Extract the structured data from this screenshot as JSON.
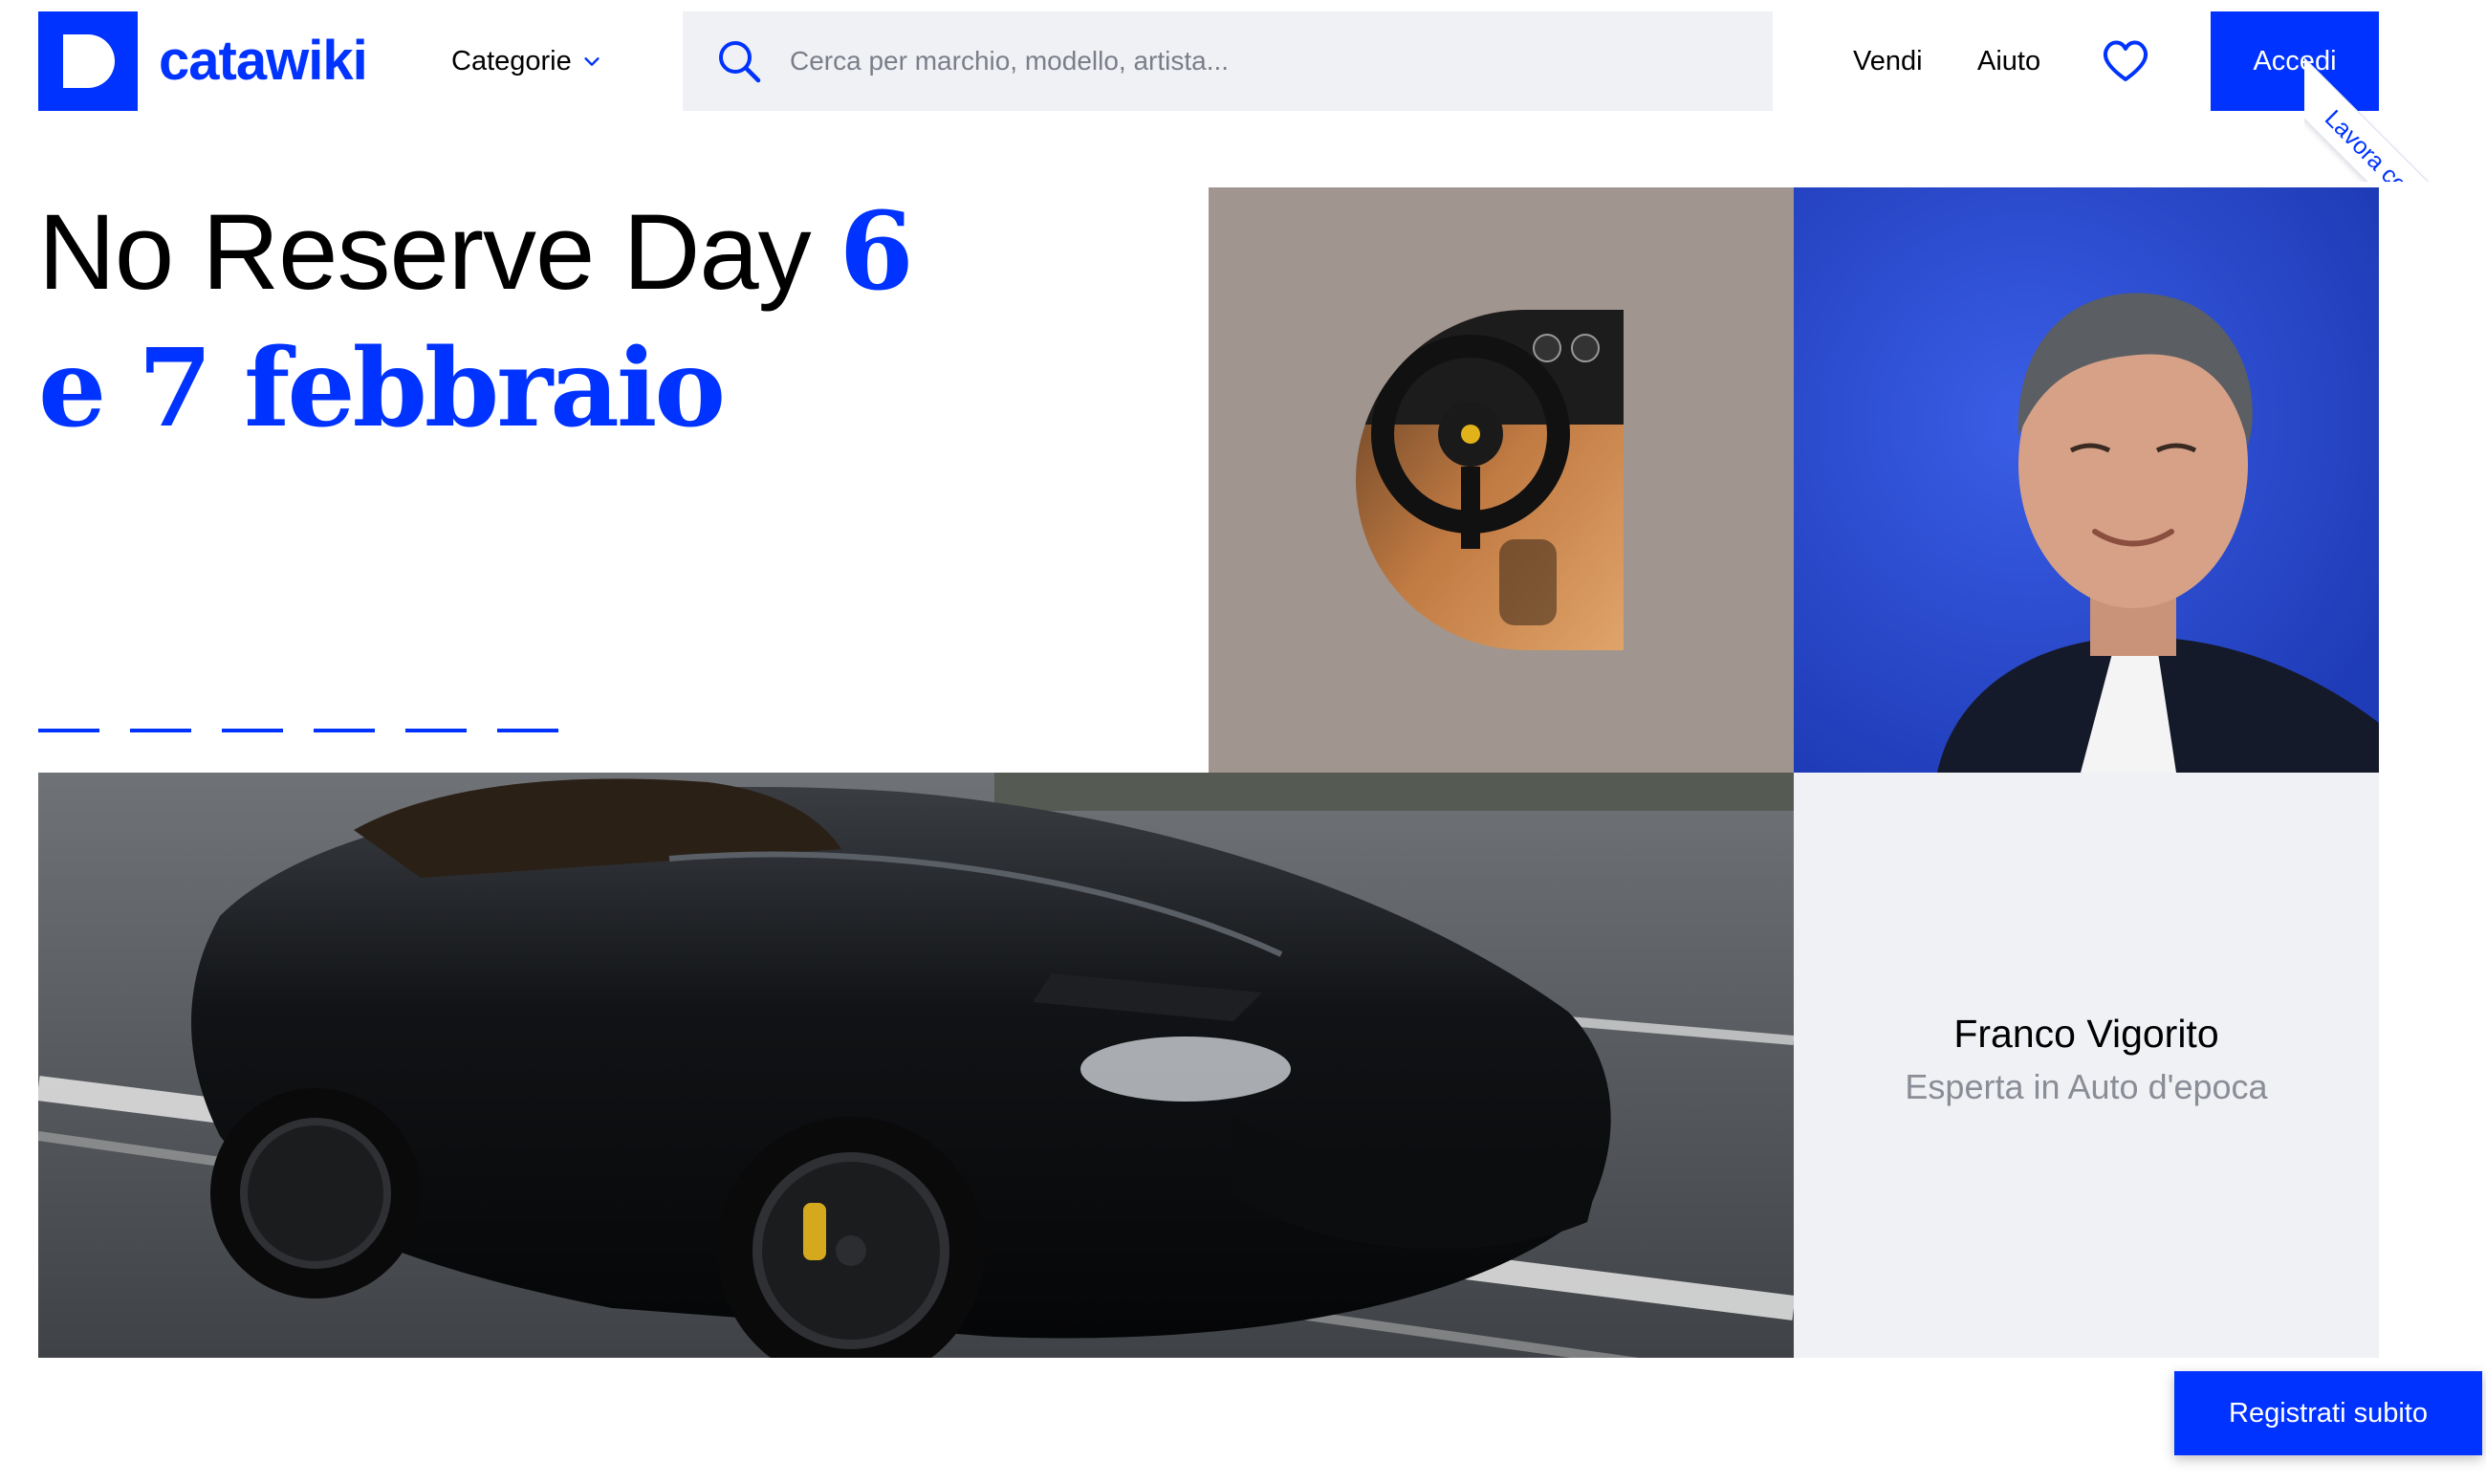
{
  "header": {
    "logo_text": "catawiki",
    "categories_label": "Categorie",
    "search_placeholder": "Cerca per marchio, modello, artista...",
    "nav": {
      "sell": "Vendi",
      "help": "Aiuto"
    },
    "login_label": "Accedi",
    "ribbon_label": "Lavora con noi!"
  },
  "hero": {
    "title_prefix": "No Reserve Day ",
    "title_num": "6",
    "title_line2": "e 7 febbraio",
    "carousel_dots": 6
  },
  "expert": {
    "name": "Franco Vigorito",
    "role": "Esperta in Auto d'epoca"
  },
  "cta": {
    "register_label": "Registrati subito"
  },
  "colors": {
    "brand": "#0033ff",
    "search_bg": "#f0f1f5",
    "tile_taupe": "#a0958f",
    "portrait_bg": "#2f4fd1",
    "muted_text": "#8a8d96"
  },
  "icons": {
    "search": "search-icon",
    "categories_chevron": "chevron-down-icon",
    "favorites": "heart-icon"
  }
}
